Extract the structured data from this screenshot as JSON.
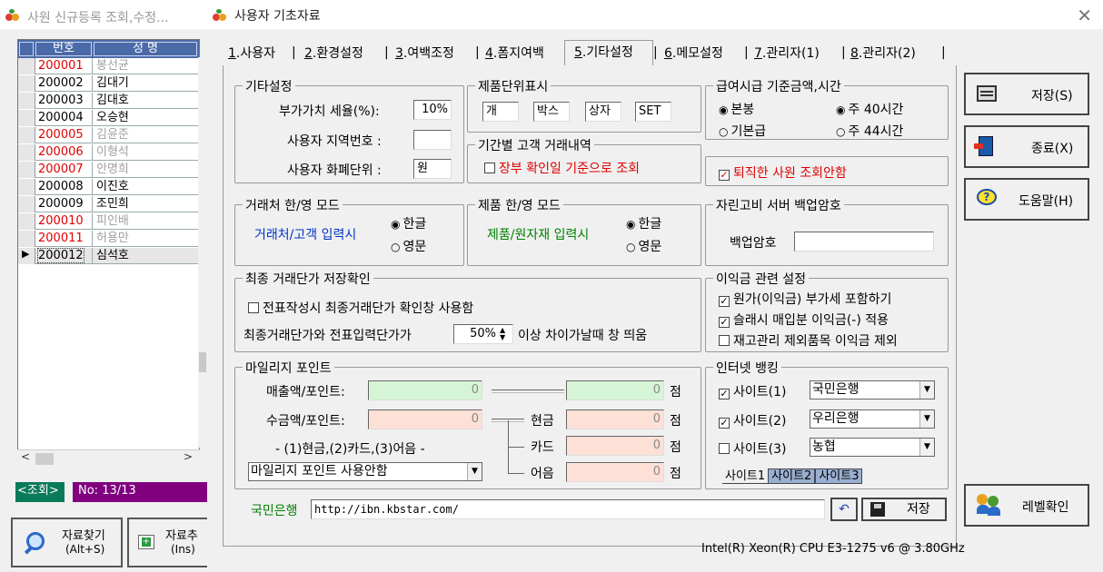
{
  "back_window": {
    "title": "사원 신규등록 조회,수정...",
    "columns": [
      "번호",
      "성 명"
    ],
    "rows": [
      {
        "id": "200001",
        "name": "봉선균",
        "retired": true
      },
      {
        "id": "200002",
        "name": "김대기",
        "retired": false
      },
      {
        "id": "200003",
        "name": "김대호",
        "retired": false
      },
      {
        "id": "200004",
        "name": "오승현",
        "retired": false
      },
      {
        "id": "200005",
        "name": "김윤준",
        "retired": true
      },
      {
        "id": "200006",
        "name": "이형석",
        "retired": true
      },
      {
        "id": "200007",
        "name": "안명희",
        "retired": true
      },
      {
        "id": "200008",
        "name": "이진호",
        "retired": false
      },
      {
        "id": "200009",
        "name": "조민희",
        "retired": false
      },
      {
        "id": "200010",
        "name": "피인배",
        "retired": true
      },
      {
        "id": "200011",
        "name": "허용만",
        "retired": true
      },
      {
        "id": "200012",
        "name": "심석호",
        "retired": false
      }
    ],
    "status_label": "<조회>",
    "status_count": "No: 13/13",
    "find_button": {
      "line1": "자료찾기",
      "line2": "(Alt+S)"
    },
    "add_button": {
      "line1": "자료추",
      "line2": "(Ins)"
    }
  },
  "dialog": {
    "title": "사용자 기초자료",
    "tabs": [
      {
        "key": "1",
        "label": ".사용자"
      },
      {
        "key": "2",
        "label": ".환경설정"
      },
      {
        "key": "3",
        "label": ".여백조정"
      },
      {
        "key": "4",
        "label": ".폼지여백"
      },
      {
        "key": "5",
        "label": ".기타설정"
      },
      {
        "key": "6",
        "label": ".메모설정"
      },
      {
        "key": "7",
        "label": ".관리자(1)"
      },
      {
        "key": "8",
        "label": ".관리자(2)"
      }
    ],
    "etc": {
      "title": "기타설정",
      "vat_label": "부가가치 세율(%):",
      "vat_value": "10%",
      "region_label": "사용자 지역번호 :",
      "region_value": "",
      "currency_label": "사용자 화폐단위 :",
      "currency_value": "원"
    },
    "unit": {
      "title": "제품단위표시",
      "units": [
        "개",
        "박스",
        "상자",
        "SET"
      ]
    },
    "period": {
      "title": "기간별 고객 거래내역",
      "check_label": "장부 확인일 기준으로 조회",
      "checked": false
    },
    "pay": {
      "title": "급여시급 기준금액,시간",
      "opt1": "본봉",
      "opt2": "기본급",
      "opt3": "주 40시간",
      "opt4": "주 44시간",
      "retired_label": "퇴직한 사원 조회안함",
      "retired_checked": true
    },
    "client_mode": {
      "title": "거래처 한/영 모드",
      "label": "거래처/고객 입력시",
      "opt1": "한글",
      "opt2": "영문"
    },
    "product_mode": {
      "title": "제품 한/영 모드",
      "label": "제품/원자재 입력시",
      "opt1": "한글",
      "opt2": "영문"
    },
    "backup": {
      "title": "자린고비 서버 백업암호",
      "label": "백업암호",
      "value": ""
    },
    "last_price": {
      "title": "최종 거래단가 저장확인",
      "check_label": "전표작성시 최종거래단가 확인창 사용함",
      "checked": false,
      "diff_label": "최종거래단가와 전표입력단가가",
      "diff_value": "50%",
      "diff_suffix": "이상 차이가날때 창 띄움"
    },
    "profit": {
      "title": "이익금 관련 설정",
      "items": [
        {
          "label": "원가(이익금) 부가세 포함하기",
          "checked": true
        },
        {
          "label": "슬래시 매입분 이익금(-) 적용",
          "checked": true
        },
        {
          "label": "재고관리 제외품목 이익금 제외",
          "checked": false
        }
      ]
    },
    "mileage": {
      "title": "마일리지 포인트",
      "sales_label": "매출액/포인트:",
      "sales_val1": "0",
      "sales_val2": "0",
      "collect_label": "수금액/포인트:",
      "collect_val1": "0",
      "cash_label": "현금",
      "cash_val": "0",
      "card_label": "카드",
      "card_val": "0",
      "bill_label": "어음",
      "bill_val": "0",
      "unit": "점",
      "note": "- (1)현금,(2)카드,(3)어음 -",
      "select_value": "마일리지 포인트 사용안함"
    },
    "banking": {
      "title": "인터넷 뱅킹",
      "sites": [
        {
          "label": "사이트(1)",
          "bank": "국민은행",
          "checked": true
        },
        {
          "label": "사이트(2)",
          "bank": "우리은행",
          "checked": true
        },
        {
          "label": "사이트(3)",
          "bank": "농협",
          "checked": false
        }
      ],
      "tabs": [
        "사이트1",
        "사이트2",
        "사이트3"
      ]
    },
    "url_bar": {
      "bank": "국민은행",
      "url": "http://ibn.kbstar.com/",
      "save": "저장"
    },
    "side_buttons": {
      "save": "저장(S)",
      "exit": "종료(X)",
      "help": "도움말(H)",
      "level": "레벨확인"
    },
    "cpu": "Intel(R) Xeon(R) CPU E3-1275 v6 @ 3.80GHz"
  }
}
